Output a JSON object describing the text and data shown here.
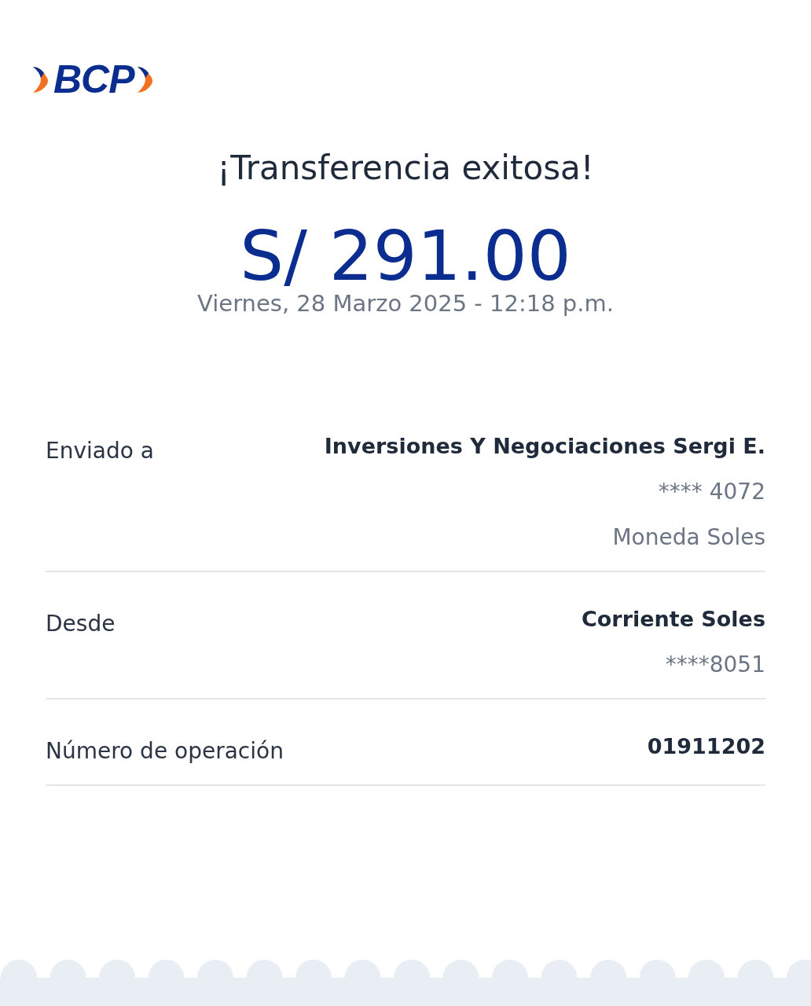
{
  "logo": {
    "text": "BCP"
  },
  "title": "¡Transferencia exitosa!",
  "amount": "S/ 291.00",
  "date": "Viernes, 28 Marzo 2025 - 12:18 p.m.",
  "rows": [
    {
      "label": "Enviado a",
      "lines": [
        {
          "text": "Inversiones Y Negociaciones Sergi E.",
          "kind": "primary"
        },
        {
          "text": "**** 4072",
          "kind": "secondary"
        },
        {
          "text": "Moneda Soles",
          "kind": "secondary"
        }
      ]
    },
    {
      "label": "Desde",
      "lines": [
        {
          "text": "Corriente Soles",
          "kind": "primary"
        },
        {
          "text": "****8051",
          "kind": "secondary"
        }
      ]
    },
    {
      "label": "Número de operación",
      "lines": [
        {
          "text": "01911202",
          "kind": "primary"
        }
      ]
    }
  ]
}
